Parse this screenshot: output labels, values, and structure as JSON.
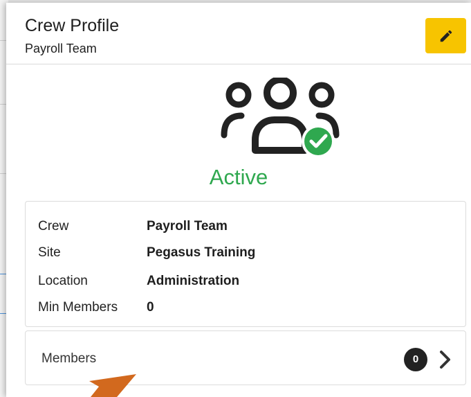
{
  "header": {
    "title": "Crew Profile",
    "subtitle": "Payroll Team"
  },
  "icons": {
    "edit": "pencil-icon",
    "crew": "crew-group-icon",
    "status": "check-circle-icon",
    "members_chevron": "chevron-right-icon"
  },
  "status": {
    "label": "Active",
    "color": "#2fa84f"
  },
  "details": {
    "rows": [
      {
        "label": "Crew",
        "value": "Payroll Team"
      },
      {
        "label": "Site",
        "value": "Pegasus Training"
      },
      {
        "label": "Location",
        "value": "Administration"
      },
      {
        "label": "Min Members",
        "value": "0"
      }
    ]
  },
  "members": {
    "label": "Members",
    "count": "0"
  },
  "colors": {
    "edit_button": "#f7c400",
    "status_green": "#2fa84f",
    "annotation_arrow": "#d2691e"
  }
}
